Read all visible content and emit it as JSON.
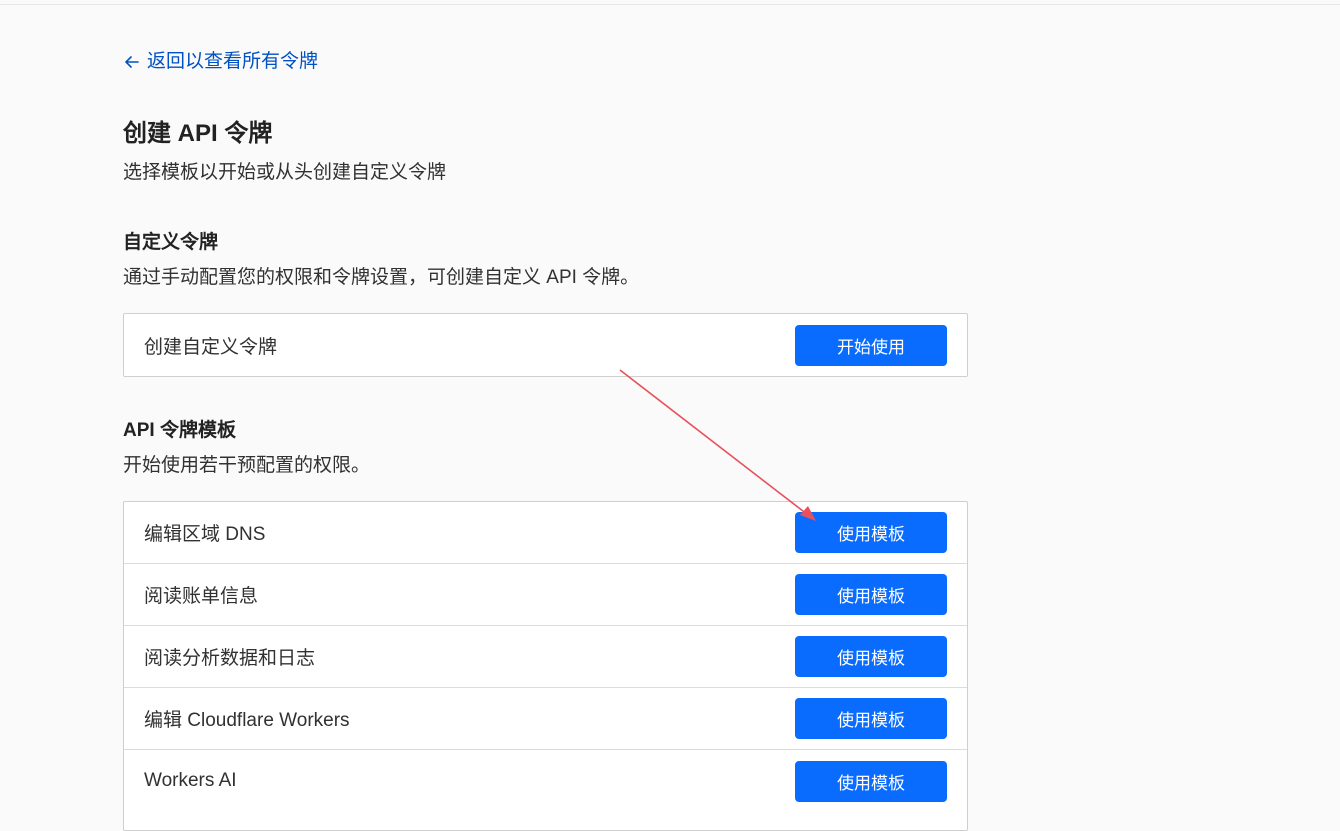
{
  "nav": {
    "back_label": "返回以查看所有令牌"
  },
  "header": {
    "title": "创建 API 令牌",
    "subtitle": "选择模板以开始或从头创建自定义令牌"
  },
  "custom_section": {
    "title": "自定义令牌",
    "description": "通过手动配置您的权限和令牌设置，可创建自定义 API 令牌。",
    "row_label": "创建自定义令牌",
    "button_label": "开始使用"
  },
  "templates_section": {
    "title": "API 令牌模板",
    "description": "开始使用若干预配置的权限。",
    "rows": [
      {
        "label": "编辑区域 DNS",
        "button": "使用模板"
      },
      {
        "label": "阅读账单信息",
        "button": "使用模板"
      },
      {
        "label": "阅读分析数据和日志",
        "button": "使用模板"
      },
      {
        "label": "编辑 Cloudflare Workers",
        "button": "使用模板"
      },
      {
        "label": "Workers AI",
        "button": "使用模板"
      }
    ]
  },
  "colors": {
    "accent": "#0a6cff",
    "link": "#0051c3",
    "annotation_arrow": "#e8505b"
  }
}
